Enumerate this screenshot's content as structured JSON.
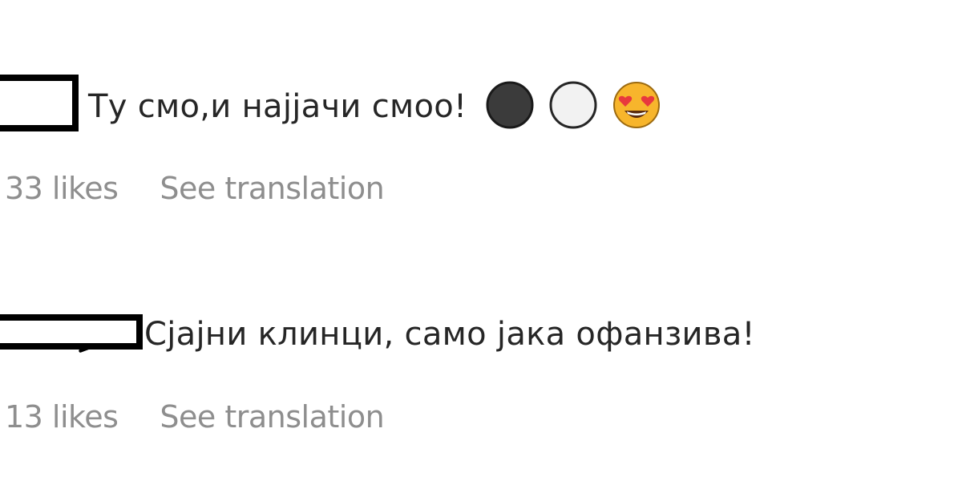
{
  "comments": [
    {
      "text": "Ту смо,и најјачи смоо!",
      "emojis": [
        "black-circle-icon",
        "white-circle-icon",
        "heart-eyes-face-icon"
      ],
      "likes": "33 likes",
      "see_translation": "See translation"
    },
    {
      "text": "Сјајни клинци, само јака офанзива!",
      "likes": "13 likes",
      "see_translation": "See translation"
    }
  ],
  "colors": {
    "text": "#262626",
    "meta": "#8e8e8e",
    "redaction": "#000000",
    "black_circle": "#3b3b3b",
    "white_circle": "#f2f2f2",
    "emoji_face": "#f7b52c",
    "emoji_heart": "#e8383d"
  }
}
